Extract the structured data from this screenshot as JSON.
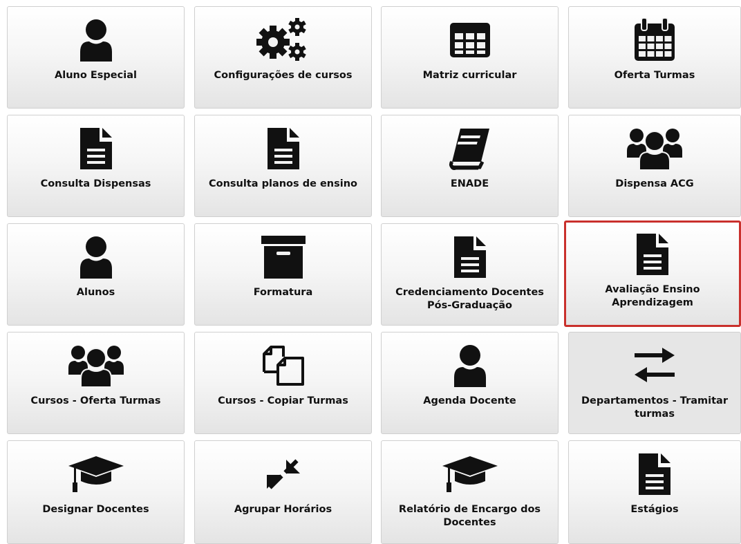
{
  "tiles": [
    {
      "label": "Aluno Especial",
      "icon": "user-icon"
    },
    {
      "label": "Configurações de cursos",
      "icon": "gears-icon"
    },
    {
      "label": "Matriz curricular",
      "icon": "table-grid-icon"
    },
    {
      "label": "Oferta Turmas",
      "icon": "calendar-icon"
    },
    {
      "label": "Consulta Dispensas",
      "icon": "document-icon"
    },
    {
      "label": "Consulta planos de ensino",
      "icon": "document-icon"
    },
    {
      "label": "ENADE",
      "icon": "book-icon"
    },
    {
      "label": "Dispensa ACG",
      "icon": "users-group-icon"
    },
    {
      "label": "Alunos",
      "icon": "user-icon"
    },
    {
      "label": "Formatura",
      "icon": "archive-box-icon"
    },
    {
      "label": "Credenciamento Docentes\nPós-Graduação",
      "icon": "document-icon"
    },
    {
      "label": "Avaliação Ensino\nAprendizagem",
      "icon": "document-icon",
      "selected": true
    },
    {
      "label": "Cursos - Oferta Turmas",
      "icon": "users-group-icon"
    },
    {
      "label": "Cursos - Copiar Turmas",
      "icon": "copy-files-icon"
    },
    {
      "label": "Agenda Docente",
      "icon": "user-icon"
    },
    {
      "label": "Departamentos - Tramitar\nturmas",
      "icon": "exchange-arrows-icon",
      "hovered": true
    },
    {
      "label": "Designar Docentes",
      "icon": "graduation-cap-icon"
    },
    {
      "label": "Agrupar Horários",
      "icon": "compress-arrows-icon"
    },
    {
      "label": "Relatório de Encargo dos\nDocentes",
      "icon": "graduation-cap-icon"
    },
    {
      "label": "Estágios",
      "icon": "document-icon"
    }
  ],
  "colors": {
    "icon": "#111111",
    "selected_border": "#c9302c",
    "tile_border": "#cfcfcf"
  }
}
